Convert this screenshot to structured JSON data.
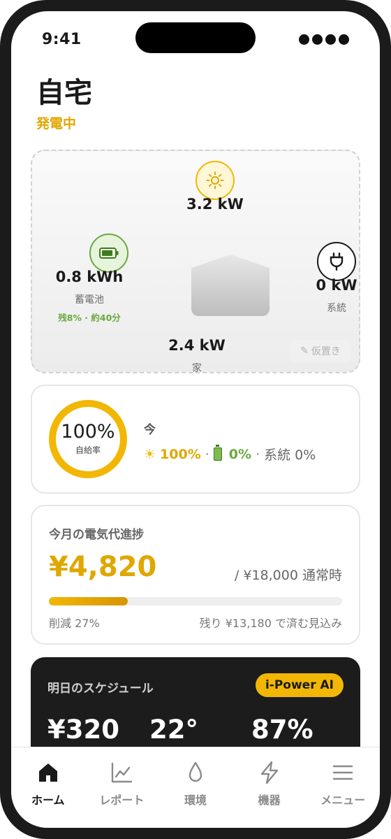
{
  "status_bar": {
    "time": "9:41"
  },
  "header": {
    "title": "自宅",
    "status": "発電中"
  },
  "energy_flow": {
    "solar": {
      "value": "3.2 kW",
      "icon": "sun-icon"
    },
    "battery": {
      "value": "0.8 kWh",
      "label": "蓄電池",
      "detail": "残8% · 約40分",
      "icon": "battery-icon"
    },
    "grid": {
      "value": "0 kW",
      "label": "系統",
      "icon": "plug-icon"
    },
    "home": {
      "value": "2.4 kW",
      "label": "家",
      "icon": "house-icon"
    },
    "placement_button": "仮置き"
  },
  "self_sufficiency": {
    "value": "100%",
    "label": "自給率",
    "level": 1.0,
    "now_label": "今",
    "solar_share": "100%",
    "battery_share": "0%",
    "grid_share": "系統 0%",
    "separator": "·"
  },
  "bill": {
    "heading": "今月の電気代進捗",
    "amount": "¥4,820",
    "normal": "/ ¥18,000 通常時",
    "progress": 0.27,
    "reduction": "削減 27%",
    "remaining": "残り ¥13,180 で済む見込み"
  },
  "schedule": {
    "title": "明日のスケジュール",
    "badge": "i-Power AI",
    "stats": [
      "¥320",
      "22°",
      "87%"
    ]
  },
  "tabs": [
    {
      "label": "ホーム",
      "icon": "home-icon",
      "active": true
    },
    {
      "label": "レポート",
      "icon": "chart-icon",
      "active": false
    },
    {
      "label": "環境",
      "icon": "drop-icon",
      "active": false
    },
    {
      "label": "機器",
      "icon": "bolt-icon",
      "active": false
    },
    {
      "label": "メニュー",
      "icon": "menu-icon",
      "active": false
    }
  ],
  "colors": {
    "accent": "#f2b705",
    "battery_green": "#6aa940",
    "dark_card": "#1c1c1c"
  }
}
